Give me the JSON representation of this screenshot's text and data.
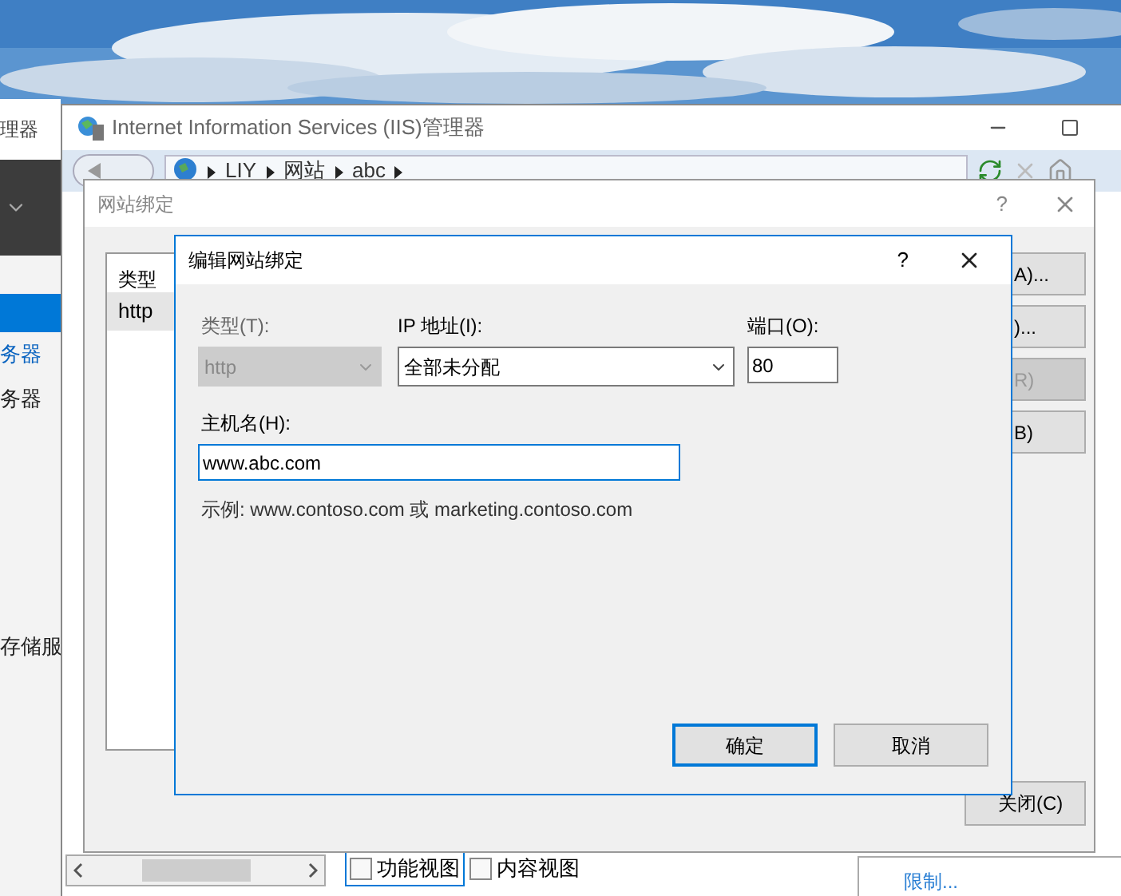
{
  "back_window": {
    "title": "理器",
    "items": [
      {
        "label": "务器",
        "selected": false
      },
      {
        "label": "务器",
        "selected": false
      },
      {
        "label": "存储服",
        "selected": false
      }
    ]
  },
  "iis_window": {
    "title": "Internet Information Services (IIS)管理器",
    "breadcrumb": [
      "LIY",
      "网站",
      "abc"
    ],
    "view_tabs": [
      {
        "label": "功能视图",
        "selected": true
      },
      {
        "label": "内容视图",
        "selected": false
      }
    ],
    "actions_link": "限制..."
  },
  "bindings_dialog": {
    "title": "网站绑定",
    "help": "?",
    "column": "类型",
    "rows": [
      {
        "label": "http",
        "selected": true
      }
    ],
    "buttons": [
      {
        "label": "A)...",
        "disabled": false
      },
      {
        "label": ")...",
        "disabled": false
      },
      {
        "label": "R)",
        "disabled": true
      },
      {
        "label": "B)",
        "disabled": false
      }
    ],
    "close_button": "关闭(C)"
  },
  "edit_dialog": {
    "title": "编辑网站绑定",
    "help": "?",
    "type_label": "类型(T):",
    "type_value": "http",
    "type_disabled": true,
    "ip_label": "IP 地址(I):",
    "ip_value": "全部未分配",
    "port_label": "端口(O):",
    "port_value": "80",
    "host_label": "主机名(H):",
    "host_value": "www.abc.com",
    "example": "示例: www.contoso.com 或 marketing.contoso.com",
    "ok": "确定",
    "cancel": "取消"
  }
}
